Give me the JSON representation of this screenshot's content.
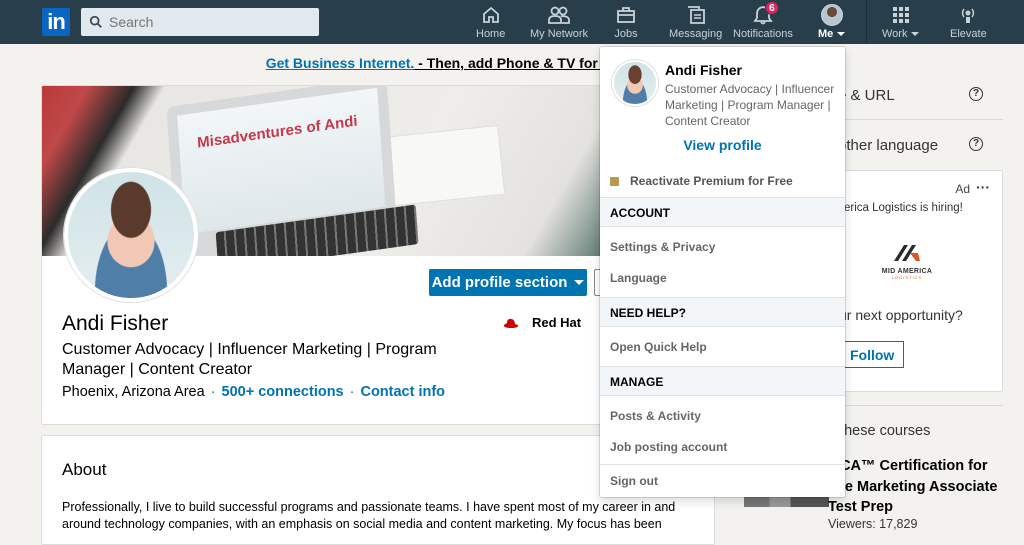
{
  "nav": {
    "logo": "in",
    "search_placeholder": "Search",
    "items": [
      {
        "label": "Home",
        "icon": "home-icon"
      },
      {
        "label": "My Network",
        "icon": "network-icon"
      },
      {
        "label": "Jobs",
        "icon": "briefcase-icon"
      },
      {
        "label": "Messaging",
        "icon": "messaging-icon"
      },
      {
        "label": "Notifications",
        "icon": "bell-icon",
        "badge": "6"
      },
      {
        "label": "Me",
        "icon": "avatar"
      },
      {
        "label": "Work",
        "icon": "grid-icon"
      },
      {
        "label": "Elevate",
        "icon": "broadcast-icon"
      }
    ]
  },
  "promo": {
    "link": "Get Business Internet.",
    "text": " - Then, add Phone & TV for just $"
  },
  "profile": {
    "banner_text": "Misadventures of Andi",
    "name": "Andi Fisher",
    "headline": "Customer Advocacy | Influencer Marketing | Program Manager | Content Creator",
    "location": "Phoenix, Arizona Area",
    "connections": "500+ connections",
    "contact": "Contact info",
    "separator": "·",
    "company": "Red Hat",
    "add_section_label": "Add profile section"
  },
  "about": {
    "title": "About",
    "text": "Professionally, I live to build successful programs and passionate teams. I have spent most of my career in and around technology companies, with an emphasis on social media and content marketing. My focus has been"
  },
  "sidebar": {
    "rows": [
      {
        "label": "e & URL"
      },
      {
        "label": "other language"
      }
    ],
    "ad": {
      "label": "Ad",
      "more": "···",
      "hiring": "erica Logistics is hiring!",
      "logo_text": "MID AMERICA",
      "logo_sub": "LOGISTICS",
      "question": "ur next opportunity?",
      "follow_label": "Follow"
    },
    "courses": {
      "title": "h these courses",
      "course_title": "MCA™ Certification for line Marketing Associate Test Prep",
      "viewers": "Viewers: 17,829"
    }
  },
  "dropdown": {
    "name": "Andi Fisher",
    "headline": "Customer Advocacy | Influencer Marketing | Program Manager | Content Creator",
    "view_profile": "View profile",
    "premium": "Reactivate Premium for Free",
    "sections": [
      {
        "title": "ACCOUNT",
        "items": [
          "Settings & Privacy",
          "Language"
        ]
      },
      {
        "title": "NEED HELP?",
        "items": [
          "Open Quick Help"
        ]
      },
      {
        "title": "MANAGE",
        "items": [
          "Posts & Activity",
          "Job posting account"
        ]
      }
    ],
    "sign_out": "Sign out"
  },
  "colors": {
    "nav_bg": "#283e4a",
    "brand_blue": "#0073b1",
    "badge_red": "#e0245e"
  }
}
